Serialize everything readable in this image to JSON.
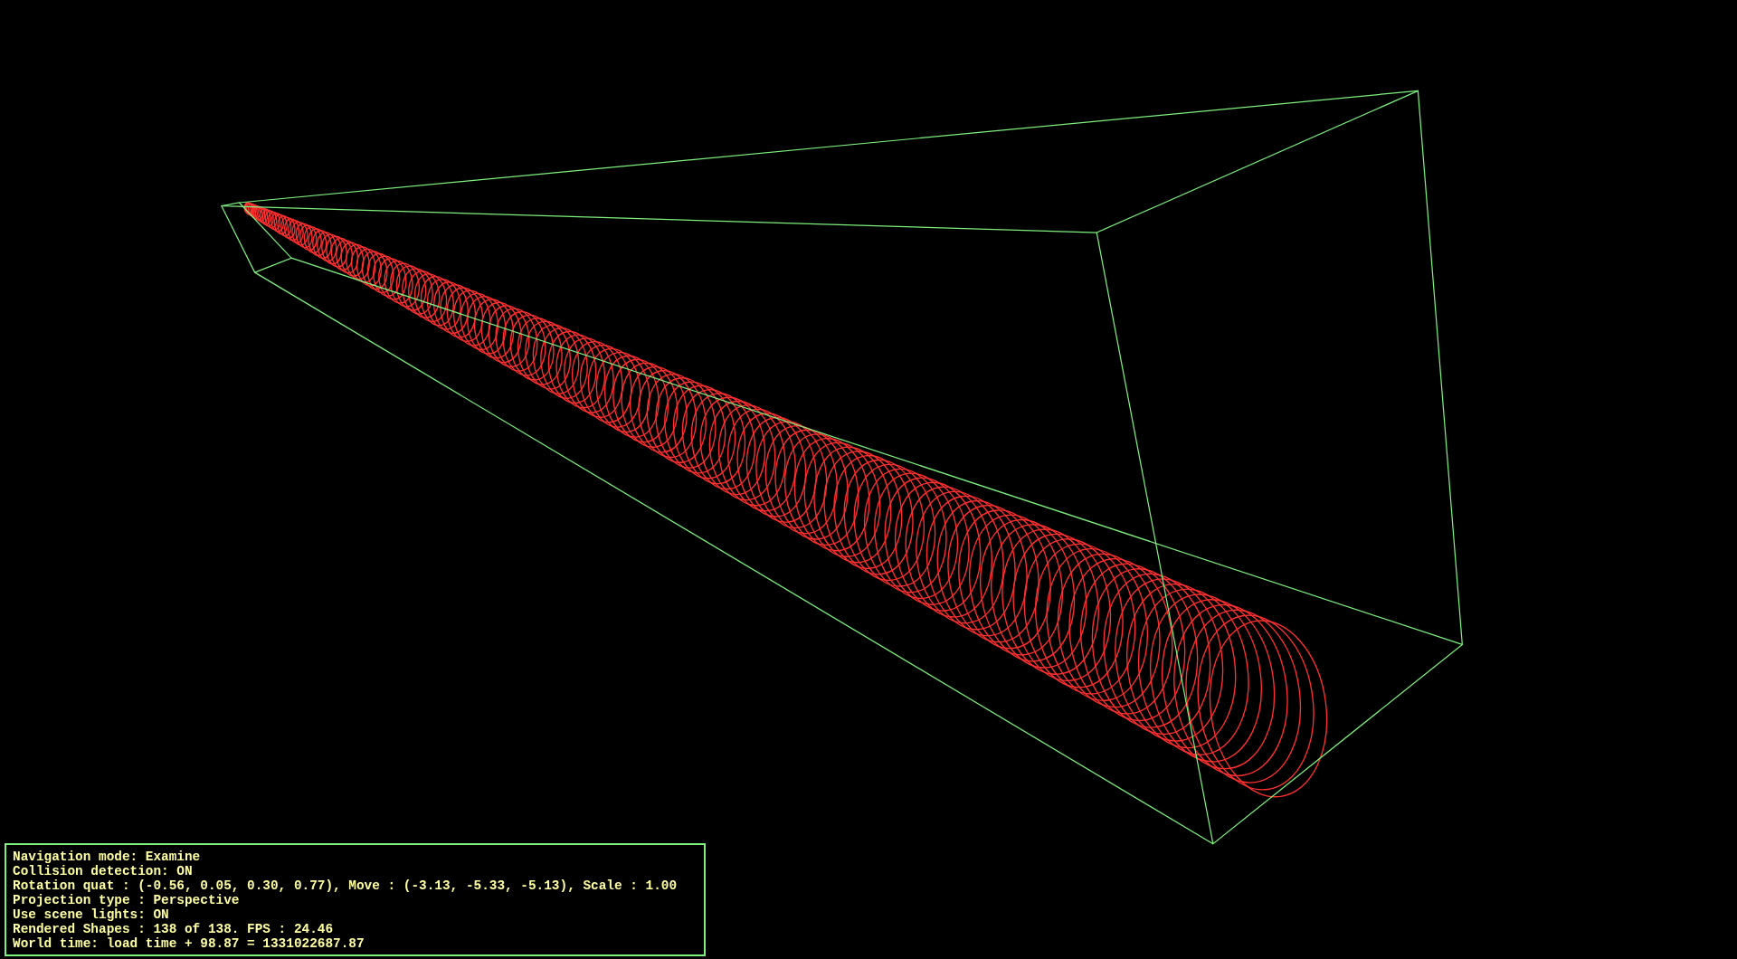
{
  "status_panel": {
    "lines": [
      "Navigation mode: Examine",
      "Collision detection: ON",
      "Rotation quat : (-0.56, 0.05, 0.30, 0.77), Move : (-3.13, -5.33, -5.13), Scale : 1.00",
      "Projection type : Perspective",
      "Use scene lights: ON",
      "Rendered Shapes : 138 of 138. FPS : 24.46",
      "World time: load time + 98.87 = 1331022687.87"
    ]
  }
}
